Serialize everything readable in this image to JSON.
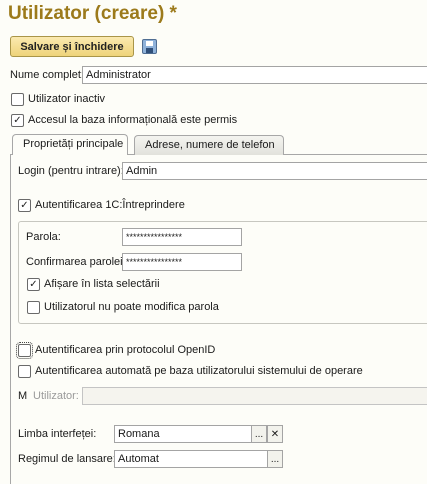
{
  "window": {
    "title": "Utilizator (creare) *"
  },
  "toolbar": {
    "save_close_label": "Salvare și închidere",
    "save_icon": "floppy-disk-icon"
  },
  "form": {
    "full_name_label": "Nume complet:",
    "full_name_value": "Administrator",
    "inactive_label": "Utilizator inactiv",
    "inactive_checked": false,
    "access_label": "Accesul la baza informațională este permis",
    "access_checked": true
  },
  "tabs": [
    {
      "label": "Proprietăți principale",
      "active": true
    },
    {
      "label": "Adrese, numere de telefon",
      "active": false
    }
  ],
  "main_props": {
    "login_label": "Login (pentru intrare):",
    "login_value": "Admin",
    "auth_1c_label": "Autentificarea 1C:Întreprindere",
    "auth_1c_checked": true,
    "password_label": "Parola:",
    "password_value": "****************",
    "confirm_label": "Confirmarea parolei:",
    "confirm_value": "****************",
    "show_in_list_label": "Afișare în lista selectării",
    "show_in_list_checked": true,
    "cannot_change_label": "Utilizatorul nu poate modifica parola",
    "cannot_change_checked": false,
    "openid_label": "Autentificarea prin protocolul OpenID",
    "openid_checked": false,
    "os_auth_label": "Autentificarea automată pe baza utilizatorului sistemului de operare",
    "os_auth_checked": false,
    "os_user_prefix": "M",
    "os_user_label": "Utilizator:",
    "os_user_value": "",
    "language_label": "Limba interfeței:",
    "language_value": "Romana",
    "mode_label": "Regimul de lansare:",
    "mode_value": "Automat",
    "ellipsis": "...",
    "clear": "✕",
    "check_mark": "✓"
  },
  "colors": {
    "title": "#9c7a1b",
    "button_bg": "#eed37a",
    "background": "#fdfdf8"
  }
}
